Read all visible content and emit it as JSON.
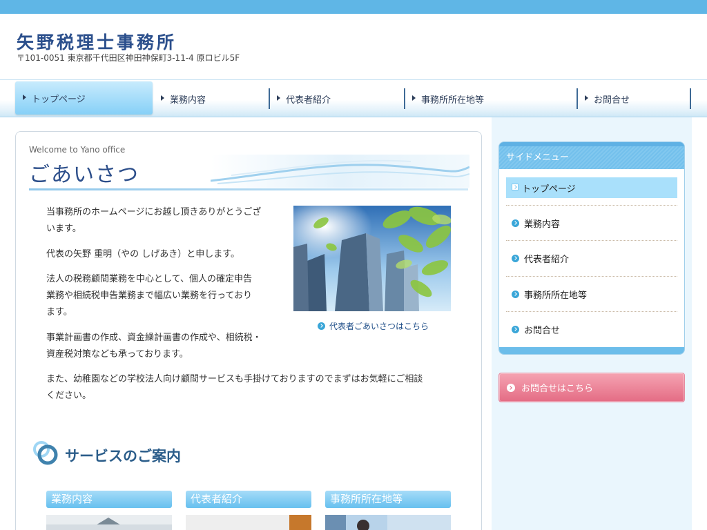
{
  "header": {
    "site_title": "矢野税理士事務所",
    "address": "〒101-0051 東京都千代田区神田神保町3-11-4 原ロビル5F"
  },
  "nav": {
    "items": [
      {
        "label": "トップページ",
        "active": true
      },
      {
        "label": "業務内容"
      },
      {
        "label": "代表者紹介"
      },
      {
        "label": "事務所所在地等"
      },
      {
        "label": "お問合せ"
      }
    ]
  },
  "main": {
    "welcome": "Welcome to Yano office",
    "title": "ごあいさつ",
    "paragraphs": [
      "当事務所のホームページにお越し頂きありがとうござ",
      "います。",
      "代表の矢野 重明（やの しげあき）と申します。",
      "法人の税務顧問業務を中心として、個人の確定申告",
      "業務や相続税申告業務まで幅広い業務を行っており",
      "ます。",
      "事業計画書の作成、資金繰計画書の作成や、相続税・",
      "資産税対策なども承っております。",
      "また、幼稚園などの学校法人向け顧問サービスも手掛けておりますのでまずはお気軽にご相談",
      "ください。"
    ],
    "photo_link": "代表者ごあいさつはこちら",
    "services_title": "サービスのご案内",
    "service_tabs": [
      "業務内容",
      "代表者紹介",
      "事務所所在地等"
    ]
  },
  "sidebar": {
    "header": "サイドメニュー",
    "items": [
      {
        "label": "トップページ",
        "active": true
      },
      {
        "label": "業務内容"
      },
      {
        "label": "代表者紹介"
      },
      {
        "label": "事務所所在地等"
      },
      {
        "label": "お問合せ"
      }
    ],
    "contact_button": "お問合せはこちら"
  },
  "colors": {
    "top_bar": "#5fb6e6",
    "title_blue": "#2c4e8a",
    "contact_pink": "#e46c84"
  }
}
